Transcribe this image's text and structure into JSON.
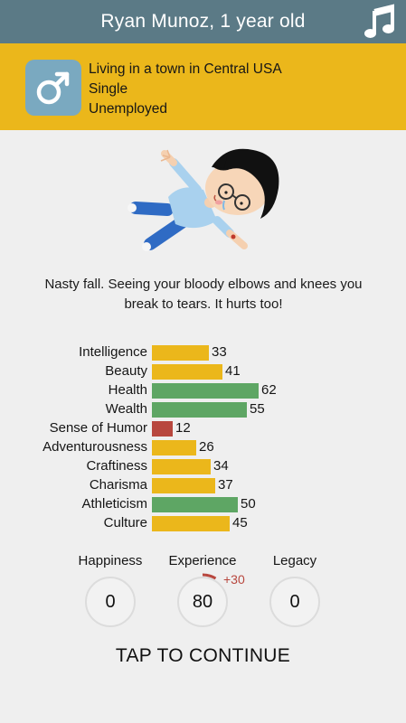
{
  "header": {
    "title": "Ryan Munoz, 1 year old",
    "music_icon": "music-note-icon",
    "bar_color": "#5b7a86"
  },
  "profile": {
    "gender_icon": "male-symbol-icon",
    "location": "Living in a town in Central USA",
    "relationship": "Single",
    "occupation": "Unemployed",
    "bar_color": "#ebb71b"
  },
  "event": {
    "image": "fallen-child-illustration",
    "text": "Nasty fall. Seeing your bloody elbows and knees you break to tears. It hurts too!"
  },
  "stats": [
    {
      "label": "Intelligence",
      "value": 33,
      "color": "#ebb71b"
    },
    {
      "label": "Beauty",
      "value": 41,
      "color": "#ebb71b"
    },
    {
      "label": "Health",
      "value": 62,
      "color": "#5ea664"
    },
    {
      "label": "Wealth",
      "value": 55,
      "color": "#5ea664"
    },
    {
      "label": "Sense of Humor",
      "value": 12,
      "color": "#b8473e"
    },
    {
      "label": "Adventurousness",
      "value": 26,
      "color": "#ebb71b"
    },
    {
      "label": "Craftiness",
      "value": 34,
      "color": "#ebb71b"
    },
    {
      "label": "Charisma",
      "value": 37,
      "color": "#ebb71b"
    },
    {
      "label": "Athleticism",
      "value": 50,
      "color": "#5ea664"
    },
    {
      "label": "Culture",
      "value": 45,
      "color": "#ebb71b"
    }
  ],
  "meters": {
    "happiness": {
      "label": "Happiness",
      "value": "0"
    },
    "experience": {
      "label": "Experience",
      "value": "80",
      "delta": "+30"
    },
    "legacy": {
      "label": "Legacy",
      "value": "0"
    }
  },
  "continue_label": "TAP TO CONTINUE"
}
